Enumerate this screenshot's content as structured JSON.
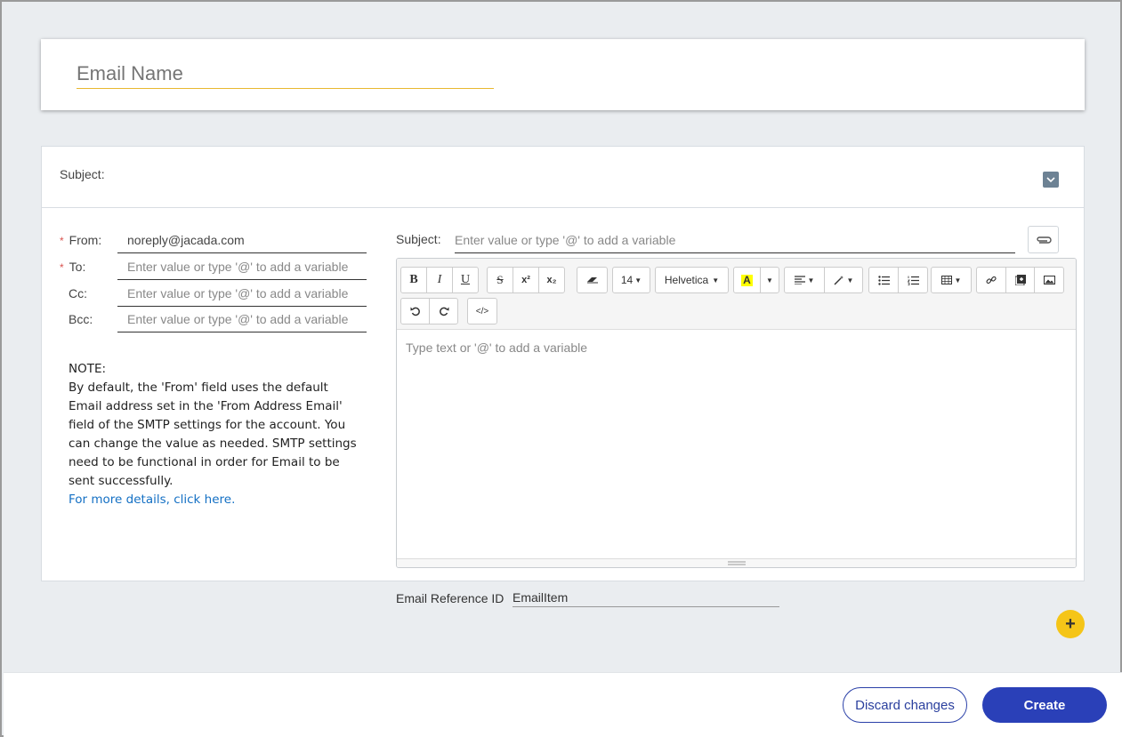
{
  "email_name": {
    "placeholder": "Email Name"
  },
  "subject_section": {
    "label": "Subject:"
  },
  "fields": {
    "from": {
      "label": "From:",
      "value": "noreply@jacada.com",
      "required": true
    },
    "to": {
      "label": "To:",
      "placeholder": "Enter value or type '@' to add a variable",
      "required": true
    },
    "cc": {
      "label": "Cc:",
      "placeholder": "Enter value or type '@' to add a variable"
    },
    "bcc": {
      "label": "Bcc:",
      "placeholder": "Enter value or type '@' to add a variable"
    }
  },
  "required_mark": "*",
  "note": {
    "title": "NOTE:",
    "body": "By default, the 'From' field uses the default Email address set in the 'From Address Email' field of the SMTP settings for the account. You can change the value as needed. SMTP settings need to be functional in order for Email to be sent successfully.",
    "link": "For more details, click here."
  },
  "editor": {
    "subject_label": "Subject:",
    "subject_placeholder": "Enter value or type '@' to add a variable",
    "body_placeholder": "Type text or '@' to add a variable",
    "toolbar": {
      "bold": "B",
      "italic": "I",
      "underline": "U",
      "strike": "S",
      "superscript": "x²",
      "subscript": "x₂",
      "font_size": "14",
      "font_family": "Helvetica",
      "highlight": "A"
    }
  },
  "reference": {
    "label": "Email Reference ID",
    "value": "EmailItem"
  },
  "footer": {
    "discard_label": "Discard changes",
    "create_label": "Create"
  },
  "colors": {
    "accent_blue": "#2a40b8",
    "add_button": "#f5c518",
    "link": "#1470c4",
    "required": "#d9534f",
    "name_underline": "#e8b830"
  },
  "icons": {
    "attach": "paperclip-icon",
    "collapse": "chevron-down-icon",
    "add": "plus-icon"
  }
}
